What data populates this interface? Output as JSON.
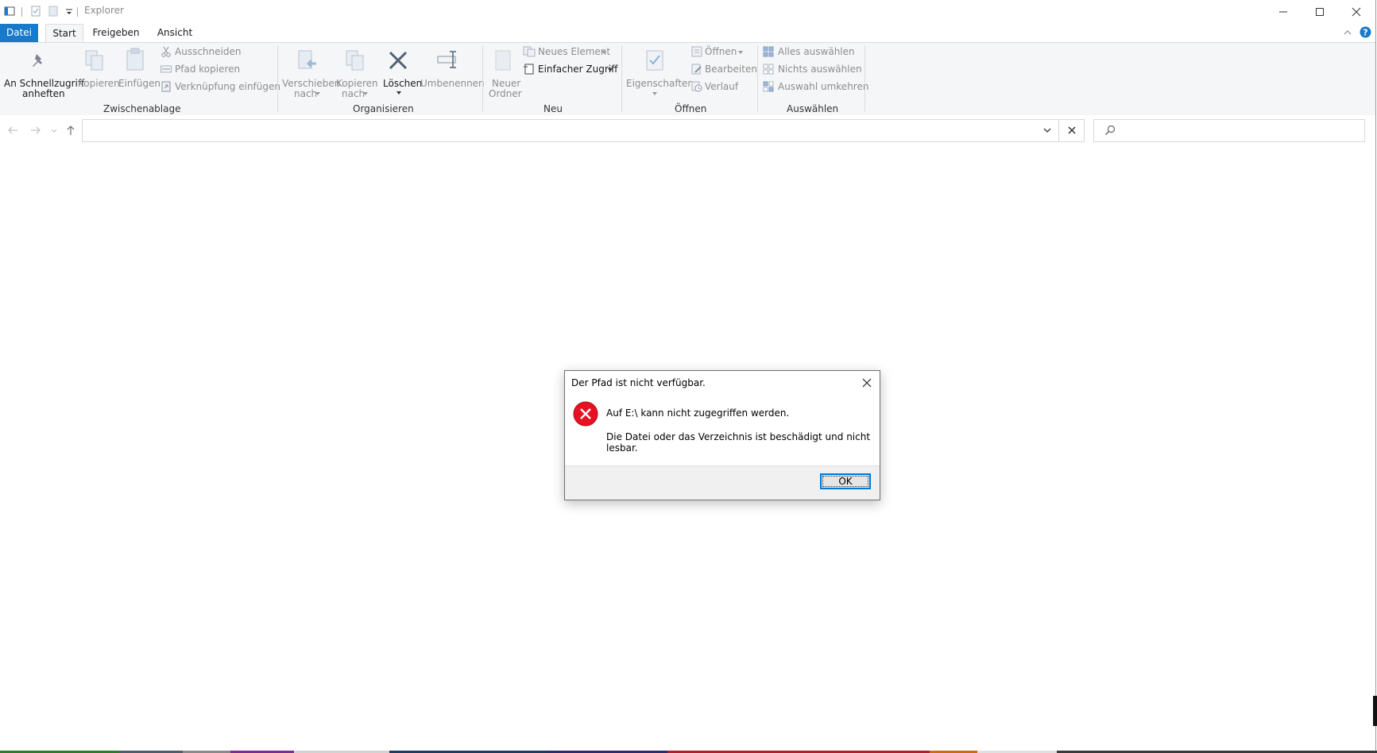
{
  "window": {
    "title": "Explorer"
  },
  "tabs": [
    {
      "label": "Datei"
    },
    {
      "label": "Start"
    },
    {
      "label": "Freigeben"
    },
    {
      "label": "Ansicht"
    }
  ],
  "ribbon": {
    "clipboard": {
      "pin_label_1": "An Schnellzugriff",
      "pin_label_2": "anheften",
      "copy": "Kopieren",
      "paste": "Einfügen",
      "cut": "Ausschneiden",
      "copy_path": "Pfad kopieren",
      "paste_shortcut": "Verknüpfung einfügen",
      "group": "Zwischenablage"
    },
    "organize": {
      "move_1": "Verschieben",
      "move_2": "nach",
      "copyto_1": "Kopieren",
      "copyto_2": "nach",
      "delete": "Löschen",
      "rename": "Umbenennen",
      "group": "Organisieren"
    },
    "new": {
      "folder_1": "Neuer",
      "folder_2": "Ordner",
      "new_item": "Neues Element",
      "easy_access": "Einfacher Zugriff",
      "group": "Neu"
    },
    "open": {
      "properties": "Eigenschaften",
      "open": "Öffnen",
      "edit": "Bearbeiten",
      "history": "Verlauf",
      "group": "Öffnen"
    },
    "select": {
      "select_all": "Alles auswählen",
      "select_none": "Nichts auswählen",
      "invert": "Auswahl umkehren",
      "group": "Auswählen"
    }
  },
  "dialog": {
    "title": "Der Pfad ist nicht verfügbar.",
    "message_1": "Auf E:\\ kann nicht zugegriffen werden.",
    "message_2": "Die Datei oder das Verzeichnis ist beschädigt und nicht lesbar.",
    "ok": "OK"
  },
  "colors": {
    "accent": "#1979ca",
    "error": "#e81123",
    "ribbon_bg": "#f5f6f7",
    "dialog_footer": "#f0f0f0"
  }
}
